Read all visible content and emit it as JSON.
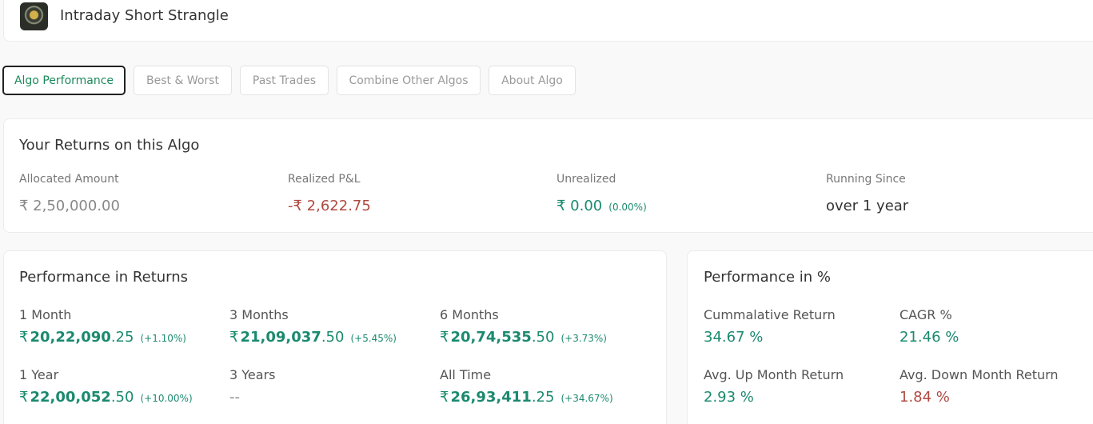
{
  "header": {
    "title": "Intraday Short Strangle"
  },
  "tabs": [
    "Algo Performance",
    "Best & Worst",
    "Past Trades",
    "Combine Other Algos",
    "About Algo"
  ],
  "returns": {
    "title": "Your Returns on this Algo",
    "allocated_label": "Allocated Amount",
    "allocated_value": "₹ 2,50,000.00",
    "realized_label": "Realized P&L",
    "realized_value": "-₹ 2,622.75",
    "unrealized_label": "Unrealized",
    "unrealized_value": "₹ 0.00",
    "unrealized_pct": "(0.00%)",
    "running_label": "Running Since",
    "running_value": "over 1 year"
  },
  "performance_returns": {
    "title": "Performance in Returns",
    "items": [
      {
        "label": "1 Month",
        "currency": "₹",
        "main": "20,22,090",
        "dec": ".25",
        "pct": "(+1.10%)"
      },
      {
        "label": "3 Months",
        "currency": "₹",
        "main": "21,09,037",
        "dec": ".50",
        "pct": "(+5.45%)"
      },
      {
        "label": "6 Months",
        "currency": "₹",
        "main": "20,74,535",
        "dec": ".50",
        "pct": "(+3.73%)"
      },
      {
        "label": "1 Year",
        "currency": "₹",
        "main": "22,00,052",
        "dec": ".50",
        "pct": "(+10.00%)"
      },
      {
        "label": "3 Years",
        "value": "--"
      },
      {
        "label": "All Time",
        "currency": "₹",
        "main": "26,93,411",
        "dec": ".25",
        "pct": "(+34.67%)"
      }
    ]
  },
  "performance_pct": {
    "title": "Performance in %",
    "cumulative_label": "Cummalative Return",
    "cumulative_value": "34.67 %",
    "cagr_label": "CAGR %",
    "cagr_value": "21.46 %",
    "avg_up_label": "Avg. Up Month Return",
    "avg_up_value": "2.93 %",
    "avg_down_label": "Avg. Down Month Return",
    "avg_down_value": "1.84 %"
  },
  "colors": {
    "green": "#1b8a6f",
    "red": "#b04a40",
    "accent": "#1b8a5a"
  }
}
